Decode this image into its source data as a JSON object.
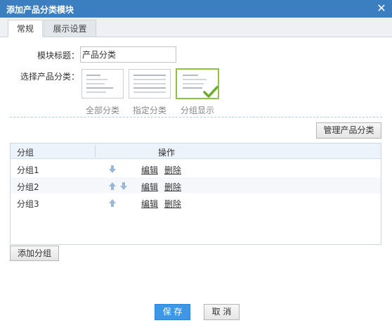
{
  "dialog": {
    "title": "添加产品分类模块",
    "close_glyph": "✕"
  },
  "tabs": [
    {
      "label": "常规",
      "active": true
    },
    {
      "label": "展示设置",
      "active": false
    }
  ],
  "form": {
    "module_title_label": "模块标题：",
    "module_title_value": "产品分类",
    "select_label": "选择产品分类：",
    "options": [
      {
        "label": "全部分类",
        "selected": false
      },
      {
        "label": "指定分类",
        "selected": false
      },
      {
        "label": "分组显示",
        "selected": true
      }
    ]
  },
  "manage_button": "管理产品分类",
  "table": {
    "headers": {
      "group": "分组",
      "action": "操作"
    },
    "rows": [
      {
        "name": "分组1",
        "edit": "编辑",
        "delete": "删除",
        "up": false,
        "down": true
      },
      {
        "name": "分组2",
        "edit": "编辑",
        "delete": "删除",
        "up": true,
        "down": true
      },
      {
        "name": "分组3",
        "edit": "编辑",
        "delete": "删除",
        "up": true,
        "down": false
      }
    ]
  },
  "add_group_button": "添加分组",
  "footer": {
    "save": "保 存",
    "cancel": "取 消"
  },
  "colors": {
    "titlebar": "#3c7fc1",
    "accent_green": "#8cc63f",
    "save_blue": "#3d97e8",
    "arrow": "#9bb8d8"
  }
}
